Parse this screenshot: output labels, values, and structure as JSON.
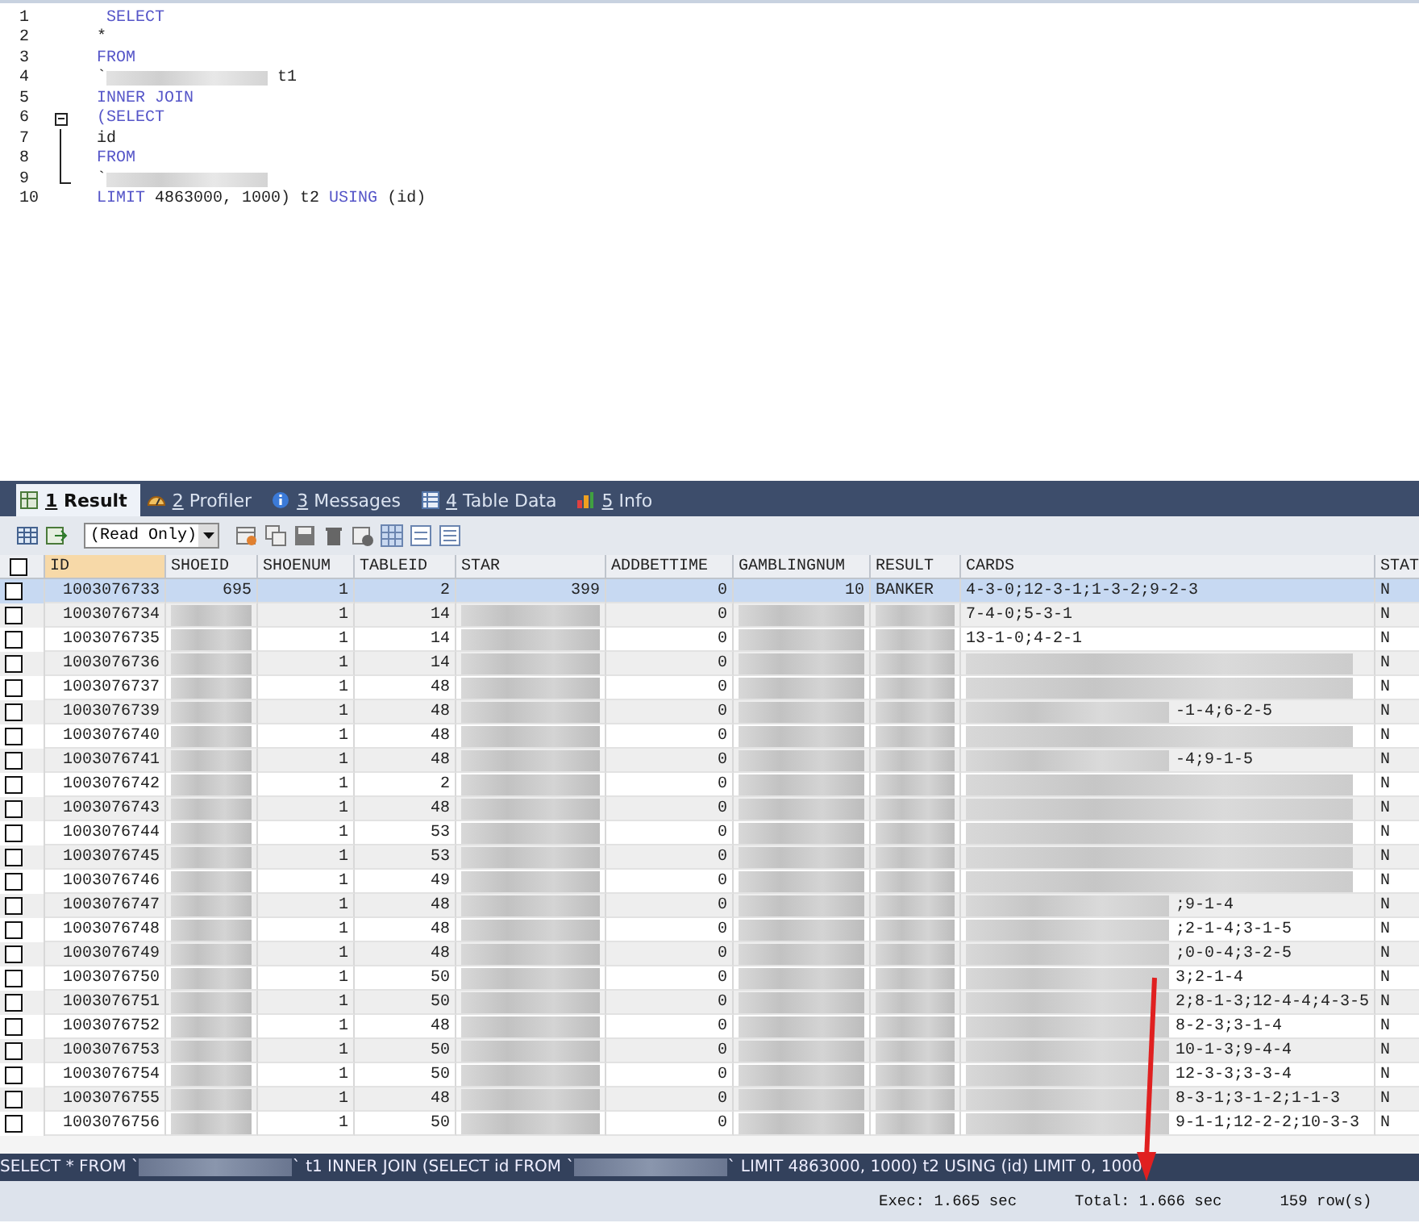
{
  "editor": {
    "lines": [
      {
        "number": "1",
        "tokens": [
          {
            "kind": "keyword",
            "text": " SELECT"
          }
        ]
      },
      {
        "number": "2",
        "tokens": [
          {
            "kind": "plain",
            "text": "*"
          }
        ]
      },
      {
        "number": "3",
        "tokens": [
          {
            "kind": "keyword",
            "text": "FROM"
          }
        ]
      },
      {
        "number": "4",
        "tokens": [
          {
            "kind": "plain",
            "text": "`"
          },
          {
            "kind": "redacted"
          },
          {
            "kind": "plain",
            "text": " t1"
          }
        ]
      },
      {
        "number": "5",
        "tokens": [
          {
            "kind": "keyword",
            "text": "INNER JOIN"
          }
        ]
      },
      {
        "number": "6",
        "kind": "fold-start",
        "tokens": [
          {
            "kind": "keyword",
            "text": "(SELECT"
          }
        ]
      },
      {
        "number": "7",
        "kind": "fold-body",
        "tokens": [
          {
            "kind": "plain",
            "text": "id"
          }
        ]
      },
      {
        "number": "8",
        "kind": "fold-body",
        "tokens": [
          {
            "kind": "keyword",
            "text": "FROM"
          }
        ]
      },
      {
        "number": "9",
        "kind": "fold-end",
        "tokens": [
          {
            "kind": "plain",
            "text": "`"
          },
          {
            "kind": "redacted"
          }
        ]
      },
      {
        "number": "10",
        "tokens": [
          {
            "kind": "keyword",
            "text": "LIMIT"
          },
          {
            "kind": "plain",
            "text": " 4863000, 1000) t2 "
          },
          {
            "kind": "keyword",
            "text": "USING"
          },
          {
            "kind": "plain",
            "text": " (id)"
          }
        ]
      }
    ]
  },
  "tabs": [
    {
      "key": "1",
      "label": "Result",
      "selected": true
    },
    {
      "key": "2",
      "label": "Profiler",
      "selected": false
    },
    {
      "key": "3",
      "label": "Messages",
      "selected": false
    },
    {
      "key": "4",
      "label": "Table Data",
      "selected": false
    },
    {
      "key": "5",
      "label": "Info",
      "selected": false
    }
  ],
  "toolbar": {
    "mode": "(Read Only)"
  },
  "table": {
    "all_checked": false,
    "columns": [
      "ID",
      "SHOEID",
      "SHOENUM",
      "TABLEID",
      "STAR",
      "ADDBETTIME",
      "GAMBLINGNUM",
      "RESULT",
      "CARDS",
      "STAT"
    ],
    "rows": [
      {
        "id": "1003076733",
        "shoeid": "695",
        "shoenum": "1",
        "tableid": "2",
        "start": "399",
        "addbettime": "0",
        "gamblingnum": "10",
        "result": "BANKER",
        "cards": "4-3-0;12-3-1;1-3-2;9-2-3",
        "stat": "N",
        "checked": false,
        "selected": true
      },
      {
        "id": "1003076734",
        "shoenum": "1",
        "tableid": "14",
        "addbettime": "0",
        "cards": "7-4-0;5-3-1",
        "stat": "N",
        "checked": false,
        "selected": false
      },
      {
        "id": "1003076735",
        "shoenum": "1",
        "tableid": "14",
        "addbettime": "0",
        "cards": "13-1-0;4-2-1",
        "stat": "N",
        "checked": false,
        "selected": false
      },
      {
        "id": "1003076736",
        "shoenum": "1",
        "tableid": "14",
        "addbettime": "0",
        "stat": "N",
        "checked": false,
        "selected": false
      },
      {
        "id": "1003076737",
        "shoenum": "1",
        "tableid": "48",
        "addbettime": "0",
        "stat": "N",
        "checked": false,
        "selected": false
      },
      {
        "id": "1003076739",
        "shoenum": "1",
        "tableid": "48",
        "addbettime": "0",
        "cards_end": "-1-4;6-2-5",
        "stat": "N",
        "checked": false,
        "selected": false
      },
      {
        "id": "1003076740",
        "shoenum": "1",
        "tableid": "48",
        "addbettime": "0",
        "stat": "N",
        "checked": false,
        "selected": false
      },
      {
        "id": "1003076741",
        "shoenum": "1",
        "tableid": "48",
        "addbettime": "0",
        "cards_end": "-4;9-1-5",
        "stat": "N",
        "checked": false,
        "selected": false
      },
      {
        "id": "1003076742",
        "shoenum": "1",
        "tableid": "2",
        "addbettime": "0",
        "stat": "N",
        "checked": false,
        "selected": false
      },
      {
        "id": "1003076743",
        "shoenum": "1",
        "tableid": "48",
        "addbettime": "0",
        "stat": "N",
        "checked": false,
        "selected": false
      },
      {
        "id": "1003076744",
        "shoenum": "1",
        "tableid": "53",
        "addbettime": "0",
        "stat": "N",
        "checked": false,
        "selected": false
      },
      {
        "id": "1003076745",
        "shoenum": "1",
        "tableid": "53",
        "addbettime": "0",
        "stat": "N",
        "checked": false,
        "selected": false
      },
      {
        "id": "1003076746",
        "shoenum": "1",
        "tableid": "49",
        "addbettime": "0",
        "stat": "N",
        "checked": false,
        "selected": false
      },
      {
        "id": "1003076747",
        "shoenum": "1",
        "tableid": "48",
        "addbettime": "0",
        "cards_end": ";9-1-4",
        "stat": "N",
        "checked": false,
        "selected": false
      },
      {
        "id": "1003076748",
        "shoenum": "1",
        "tableid": "48",
        "addbettime": "0",
        "cards_end": ";2-1-4;3-1-5",
        "stat": "N",
        "checked": false,
        "selected": false
      },
      {
        "id": "1003076749",
        "shoenum": "1",
        "tableid": "48",
        "addbettime": "0",
        "cards_end": ";0-0-4;3-2-5",
        "stat": "N",
        "checked": false,
        "selected": false
      },
      {
        "id": "1003076750",
        "shoenum": "1",
        "tableid": "50",
        "addbettime": "0",
        "cards_end": "3;2-1-4",
        "stat": "N",
        "checked": false,
        "selected": false
      },
      {
        "id": "1003076751",
        "shoenum": "1",
        "tableid": "50",
        "addbettime": "0",
        "cards_end": "2;8-1-3;12-4-4;4-3-5",
        "stat": "N",
        "checked": false,
        "selected": false
      },
      {
        "id": "1003076752",
        "shoenum": "1",
        "tableid": "48",
        "addbettime": "0",
        "cards_end": "8-2-3;3-1-4",
        "stat": "N",
        "checked": false,
        "selected": false
      },
      {
        "id": "1003076753",
        "shoenum": "1",
        "tableid": "50",
        "addbettime": "0",
        "cards_end": "10-1-3;9-4-4",
        "stat": "N",
        "checked": false,
        "selected": false
      },
      {
        "id": "1003076754",
        "shoenum": "1",
        "tableid": "50",
        "addbettime": "0",
        "cards_end": "12-3-3;3-3-4",
        "stat": "N",
        "checked": false,
        "selected": false
      },
      {
        "id": "1003076755",
        "shoenum": "1",
        "tableid": "48",
        "addbettime": "0",
        "cards_end": "8-3-1;3-1-2;1-1-3",
        "stat": "N",
        "checked": false,
        "selected": false
      },
      {
        "id": "1003076756",
        "shoenum": "1",
        "tableid": "50",
        "addbettime": "0",
        "cards_end": "9-1-1;12-2-2;10-3-3",
        "stat": "N",
        "checked": false,
        "selected": false
      }
    ]
  },
  "query_bar": {
    "parts": [
      "SELECT * FROM `",
      "` t1 INNER JOIN (SELECT id FROM `",
      "` LIMIT 4863000, 1000) t2 USING (id) LIMIT 0, 1000"
    ]
  },
  "status_bar": {
    "exec": "Exec: 1.665 sec",
    "total": "Total: 1.666 sec",
    "rows": "159 row(s)"
  }
}
